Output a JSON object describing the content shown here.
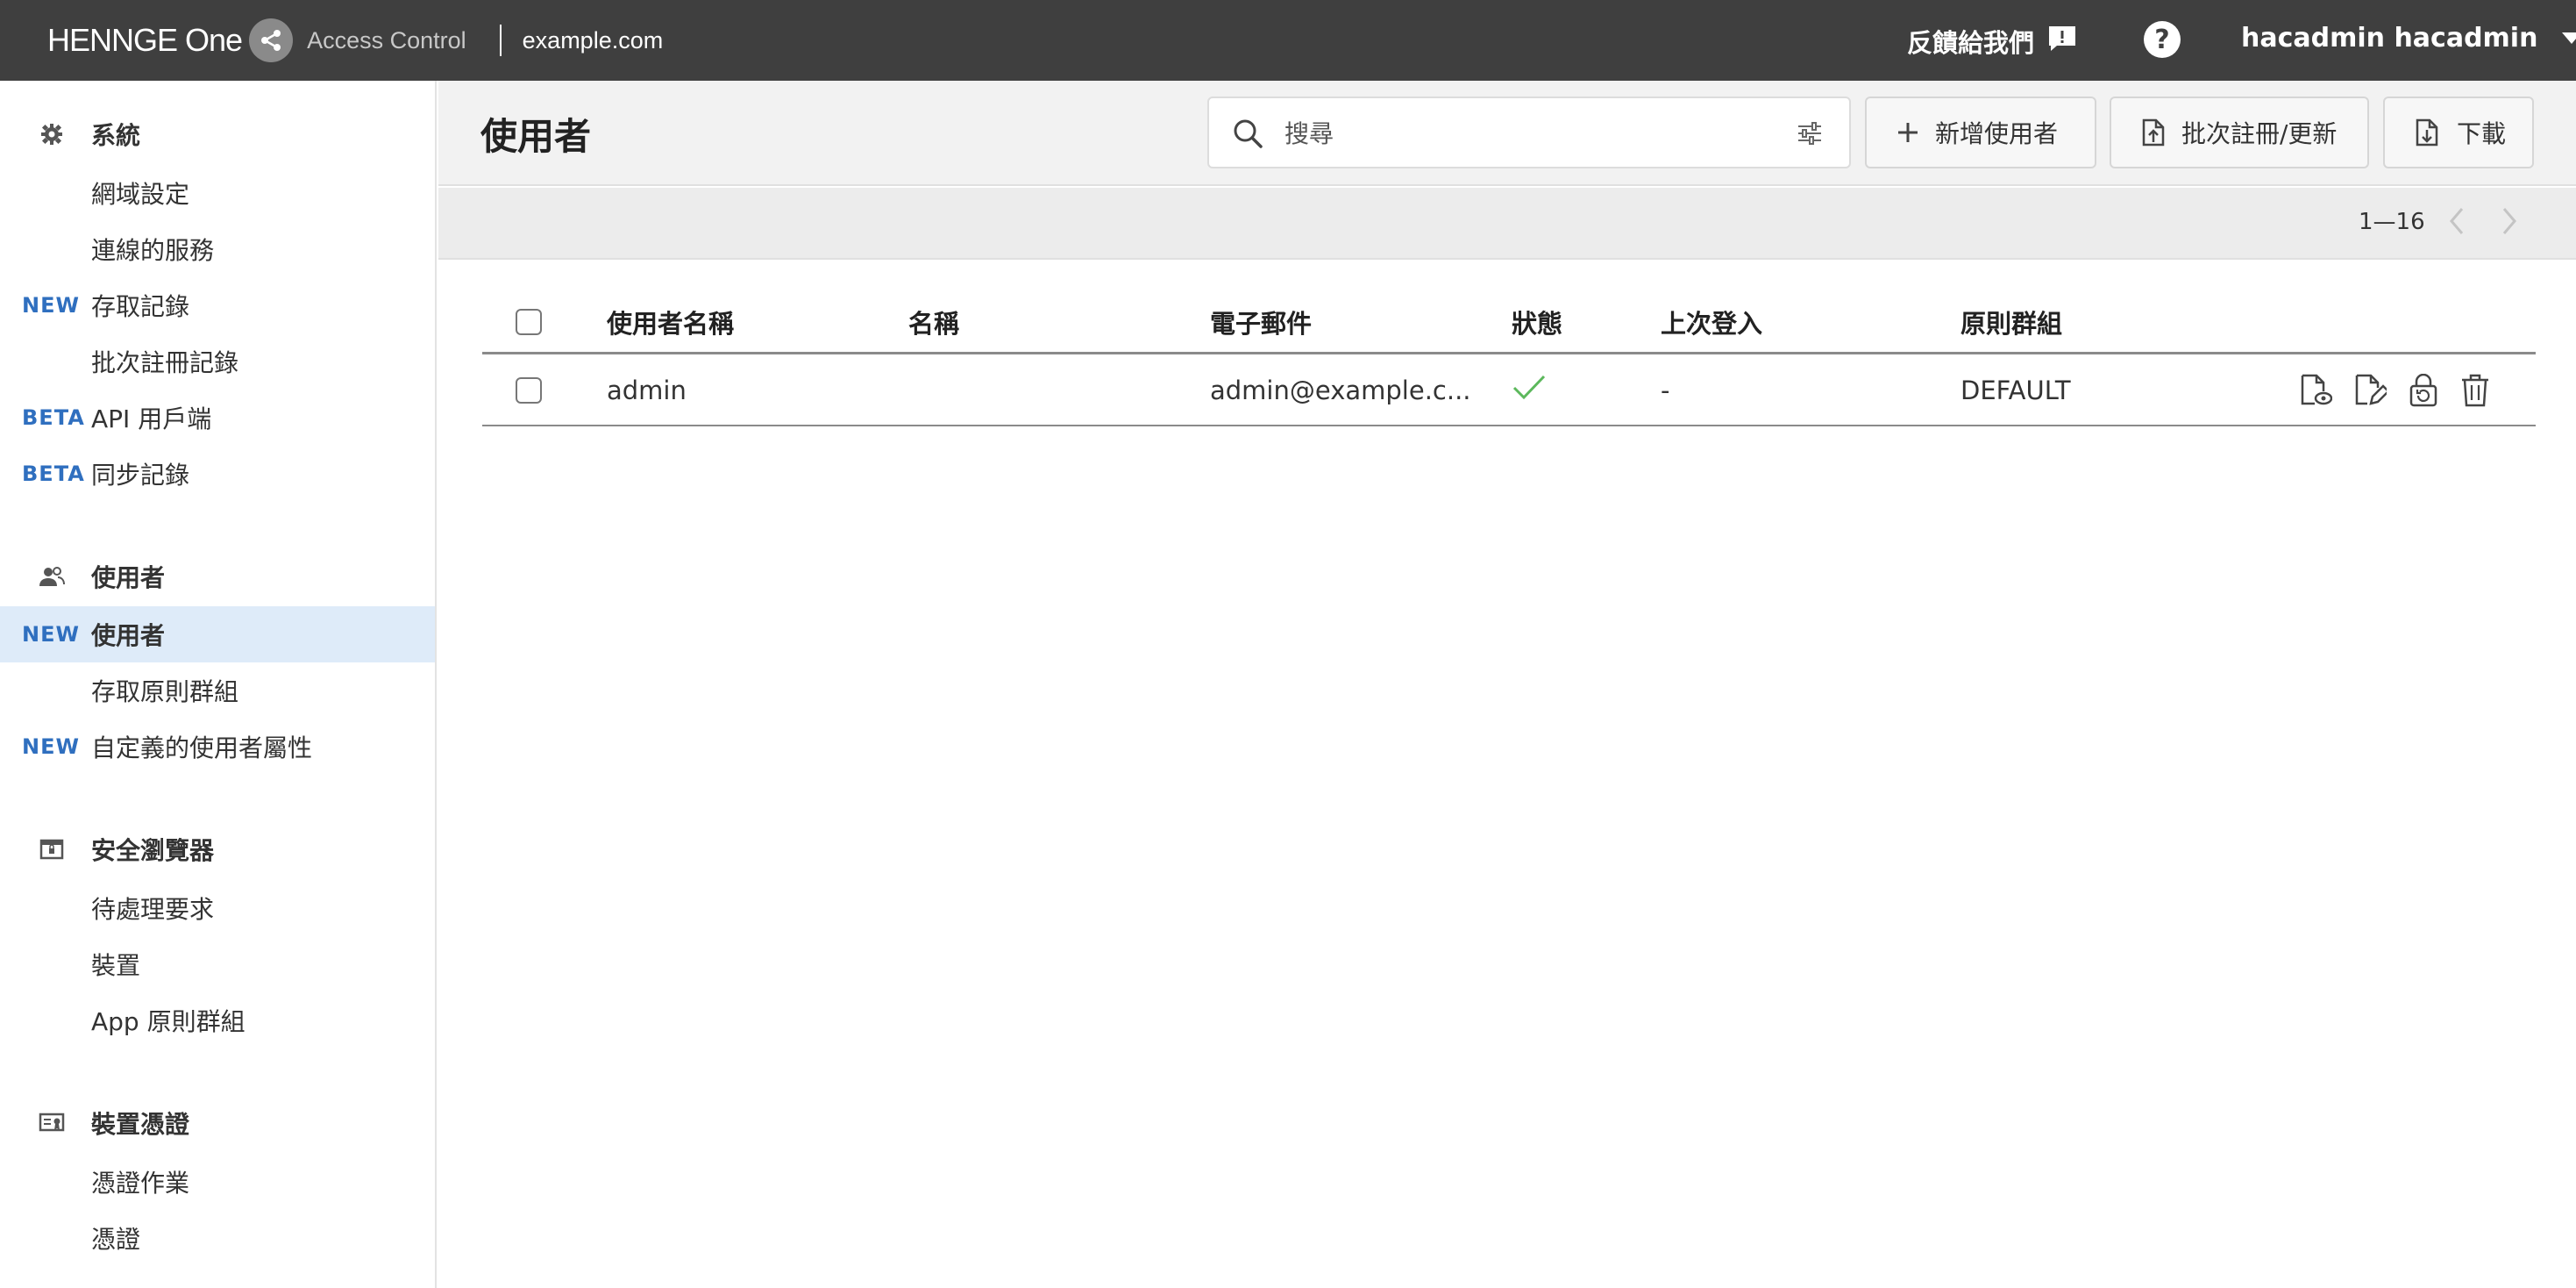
{
  "header": {
    "brand_name": "HENNGE One",
    "product_name": "Access Control",
    "domain": "example.com",
    "feedback_label": "反饋給我們",
    "help_label": "?",
    "user_name": "hacadmin hacadmin"
  },
  "sidebar": {
    "sections": [
      {
        "title": "系統",
        "icon": "gear-icon",
        "items": [
          {
            "badge": "",
            "label": "網域設定"
          },
          {
            "badge": "",
            "label": "連線的服務"
          },
          {
            "badge": "NEW",
            "label": "存取記錄"
          },
          {
            "badge": "",
            "label": "批次註冊記錄"
          },
          {
            "badge": "BETA",
            "label": "API 用戶端"
          },
          {
            "badge": "BETA",
            "label": "同步記錄"
          }
        ]
      },
      {
        "title": "使用者",
        "icon": "users-icon",
        "items": [
          {
            "badge": "NEW",
            "label": "使用者",
            "active": true
          },
          {
            "badge": "",
            "label": "存取原則群組"
          },
          {
            "badge": "NEW",
            "label": "自定義的使用者屬性"
          }
        ]
      },
      {
        "title": "安全瀏覽器",
        "icon": "secure-browser-icon",
        "items": [
          {
            "badge": "",
            "label": "待處理要求"
          },
          {
            "badge": "",
            "label": "裝置"
          },
          {
            "badge": "",
            "label": "App 原則群組"
          }
        ]
      },
      {
        "title": "裝置憑證",
        "icon": "certificate-icon",
        "items": [
          {
            "badge": "",
            "label": "憑證作業"
          },
          {
            "badge": "",
            "label": "憑證"
          }
        ]
      }
    ]
  },
  "toolbar": {
    "page_title": "使用者",
    "search_placeholder": "搜尋",
    "search_value": "",
    "add_user_label": "新增使用者",
    "bulk_label": "批次註冊/更新",
    "download_label": "下載"
  },
  "pager": {
    "range": "1—16"
  },
  "table": {
    "columns": [
      "使用者名稱",
      "名稱",
      "電子郵件",
      "狀態",
      "上次登入",
      "原則群組"
    ],
    "rows": [
      {
        "username": "admin",
        "name": "",
        "email": "admin@example.c...",
        "status": "active",
        "last_login": "-",
        "policy_group": "DEFAULT"
      }
    ]
  },
  "colors": {
    "header_bg": "#3f3f3f",
    "accent_badge": "#2f6fbf",
    "active_nav_bg": "#deebf9",
    "status_ok": "#5cb85c"
  }
}
